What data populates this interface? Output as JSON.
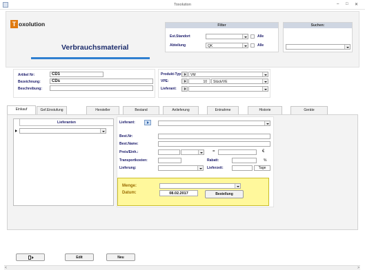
{
  "window": {
    "title": "Toxolution",
    "minimize": "–",
    "maximize": "□",
    "close": "✕"
  },
  "logo": {
    "letter": "T",
    "text": "oxolution"
  },
  "page_title": "Verbrauchsmaterial",
  "filter": {
    "header": "Filter",
    "standort_label": "Est.Standort",
    "abteilung_label": "Abteilung",
    "abteilung_value": "QK",
    "alle1": "Alle",
    "alle2": "Alle"
  },
  "suchen": {
    "header": "Suchen:"
  },
  "artikel": {
    "nr_label": "Artikel Nr:",
    "nr_value": "CD1",
    "bez_label": "Bezeichnung:",
    "bez_value": "CDs",
    "beschr_label": "Beschreibung:"
  },
  "produkt": {
    "typ_label": "Produkt-Typ:",
    "typ_value": "VM",
    "vpe_label": "VPE:",
    "vpe_qty": "10",
    "vpe_unit": "Stück/VE",
    "lieferant_label": "Lieferant:"
  },
  "tabs": [
    "Einkauf",
    "Gef.Einstufung",
    "Hersteller",
    "Bestand",
    "Anlieferung",
    "Entnahme",
    "Historie",
    "Geräte"
  ],
  "lieferanten_header": "Lieferanten",
  "details": {
    "lieferant_label": "Lieferant:",
    "bestnr_label": "Best.Nr:",
    "bestname_label": "Best.Name:",
    "preis_label": "Preis/Einh.:",
    "preis_eq": "=",
    "currency": "€",
    "transport_label": "Transportkosten:",
    "rabatt_label": "Rabatt:",
    "percent": "%",
    "lieferung_label": "Lieferung:",
    "lieferzeit_label": "Lieferzeit:",
    "tage": "Tage"
  },
  "order": {
    "menge_label": "Menge:",
    "datum_label": "Datum:",
    "datum_value": "08.02.2017",
    "bestellung_button": "Bestellung"
  },
  "buttons": {
    "edit": "Edit",
    "neu": "Neu"
  },
  "scrollbar": {
    "left": "<",
    "right": ">"
  }
}
